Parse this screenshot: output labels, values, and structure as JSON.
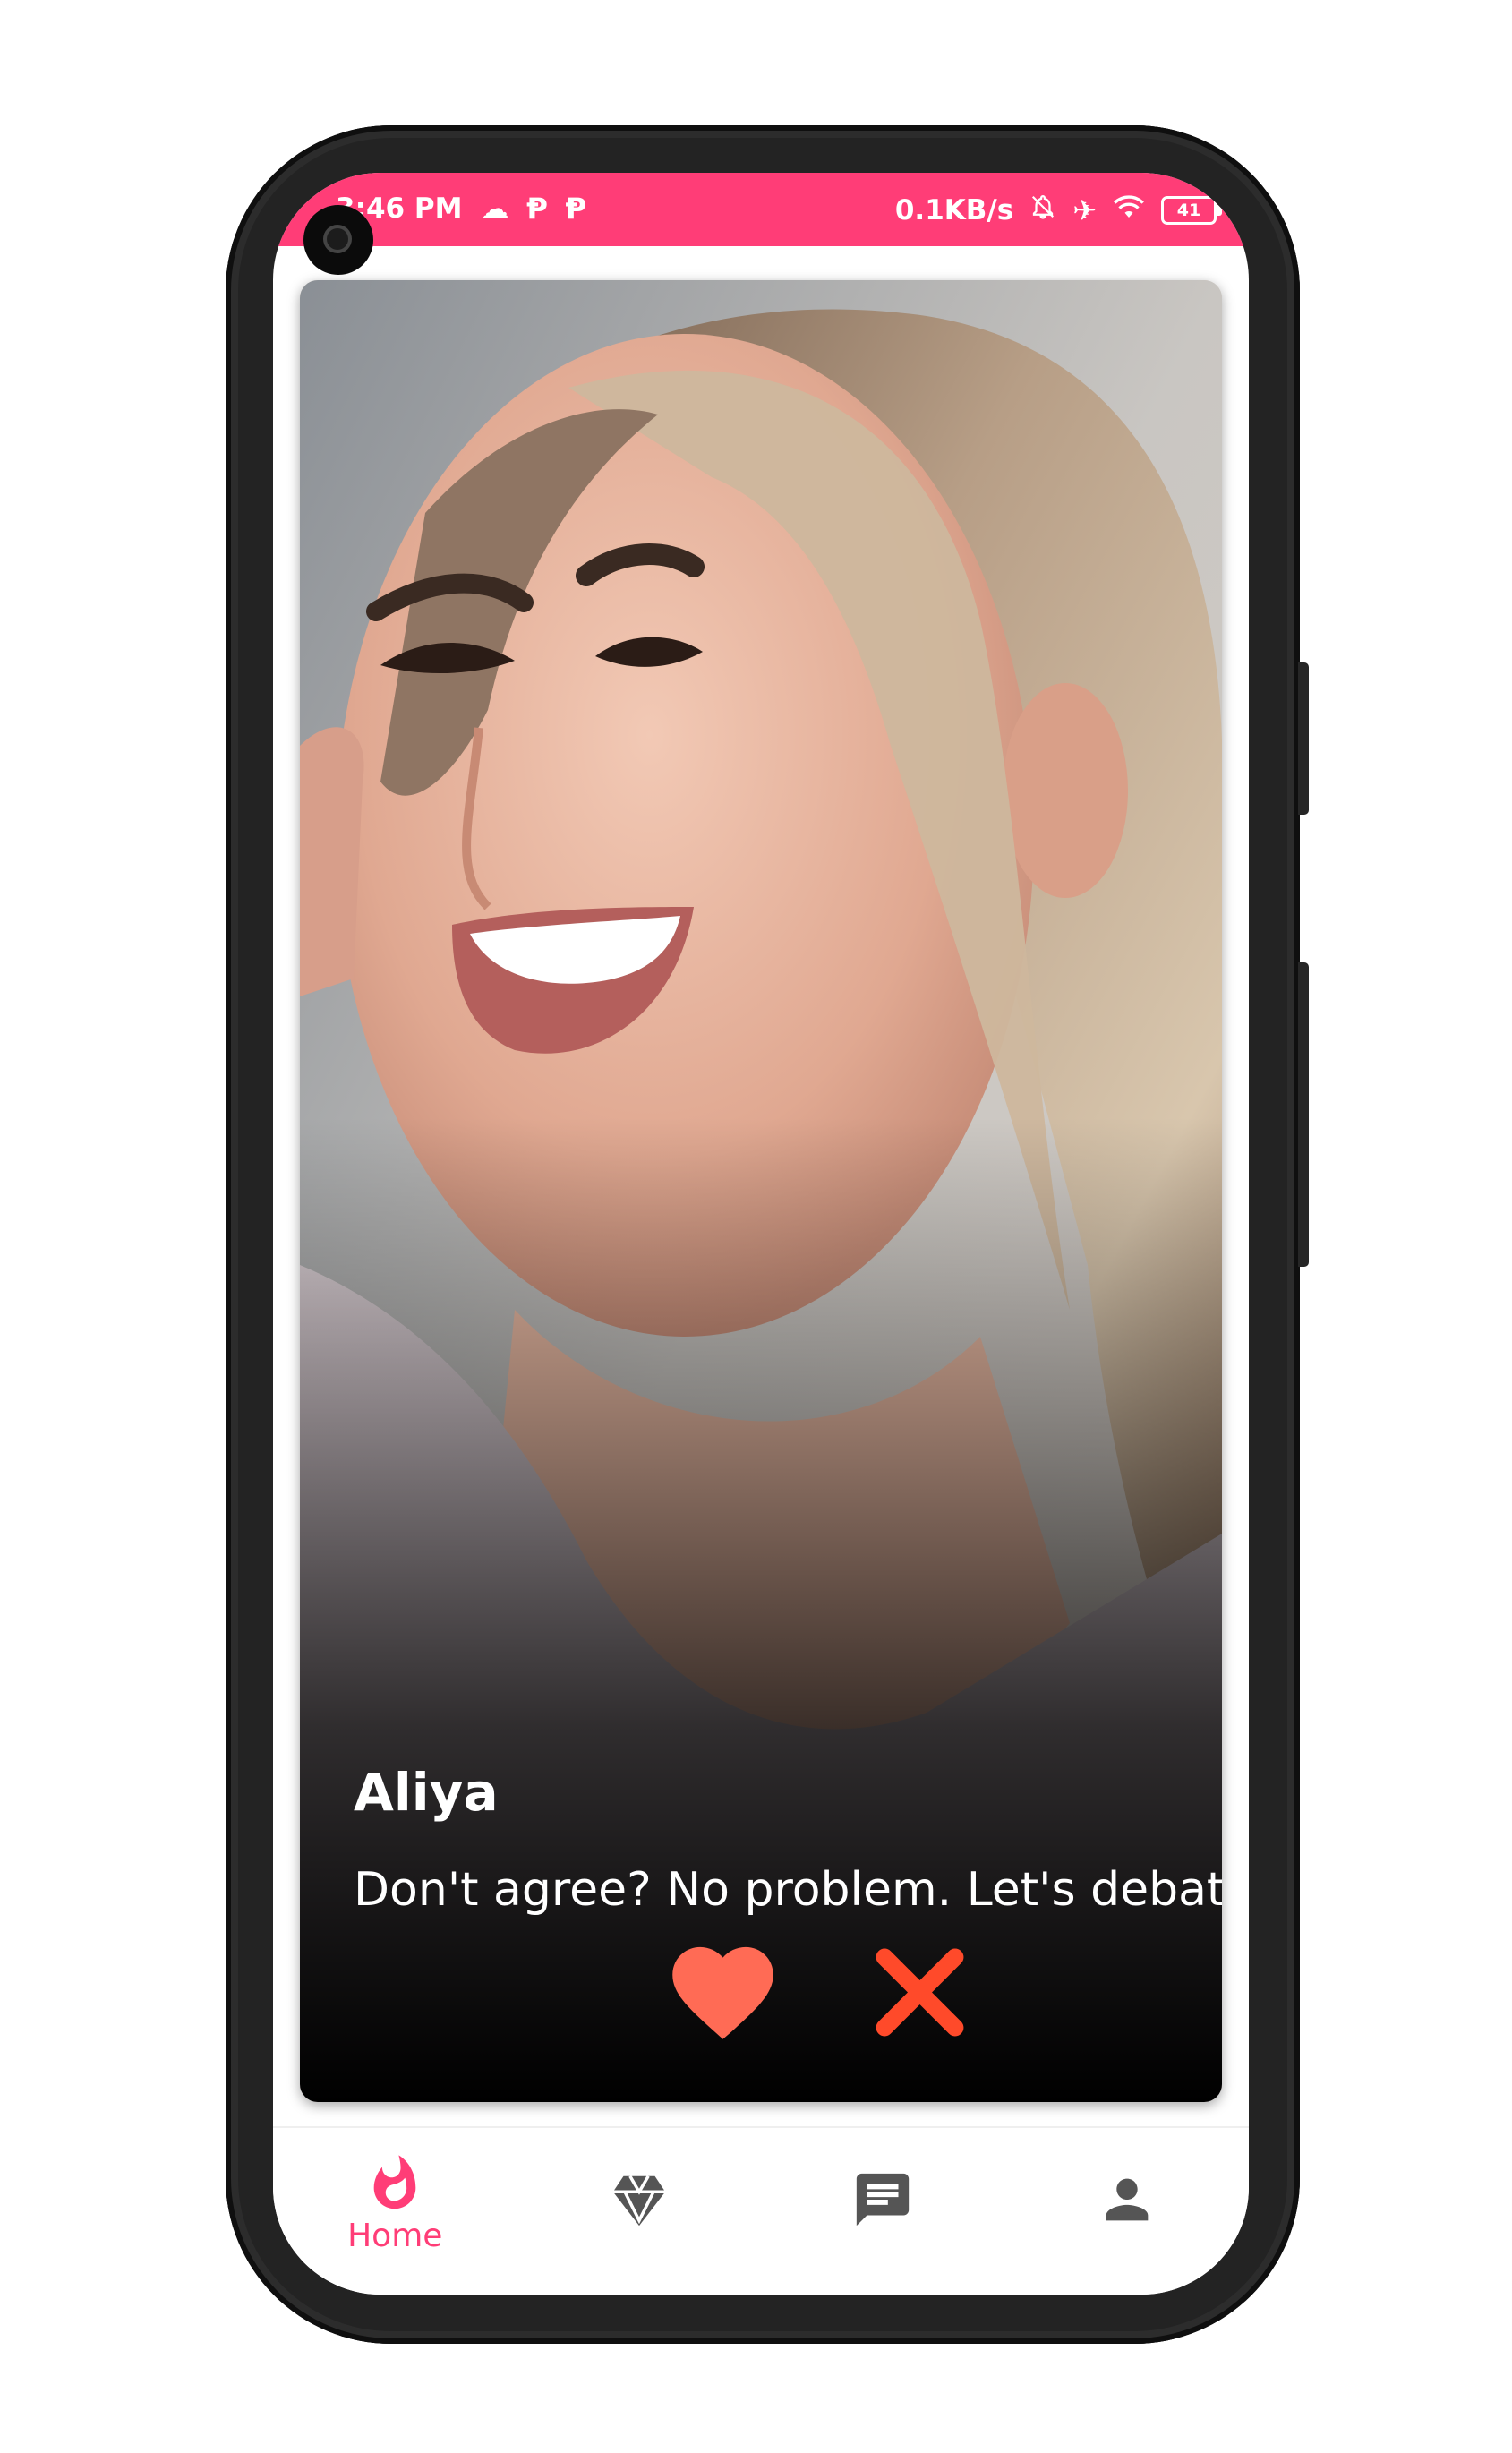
{
  "status_bar": {
    "time": "3:46 PM",
    "network_speed": "0.1KB/s",
    "battery_level": "41",
    "left_icons": [
      "cloud-icon",
      "p-app-icon",
      "p-app-icon"
    ],
    "right_icons": [
      "mute-bell-icon",
      "airplane-icon",
      "wifi-icon",
      "battery-icon"
    ],
    "background_color": "#ff3d77"
  },
  "profile_card": {
    "name": "Aliya",
    "bio": "Don't agree? No problem. Let's debate.",
    "actions": [
      {
        "id": "like",
        "icon": "heart-icon",
        "color": "#ff6b55"
      },
      {
        "id": "nope",
        "icon": "close-x-icon",
        "color": "#ff4a2a"
      }
    ]
  },
  "bottom_nav": {
    "items": [
      {
        "icon": "flame-icon",
        "label": "Home",
        "active": true
      },
      {
        "icon": "diamond-icon",
        "label": "",
        "active": false
      },
      {
        "icon": "chat-icon",
        "label": "",
        "active": false
      },
      {
        "icon": "person-icon",
        "label": "",
        "active": false
      }
    ],
    "active_color": "#ff3d77",
    "inactive_color": "#555555"
  }
}
